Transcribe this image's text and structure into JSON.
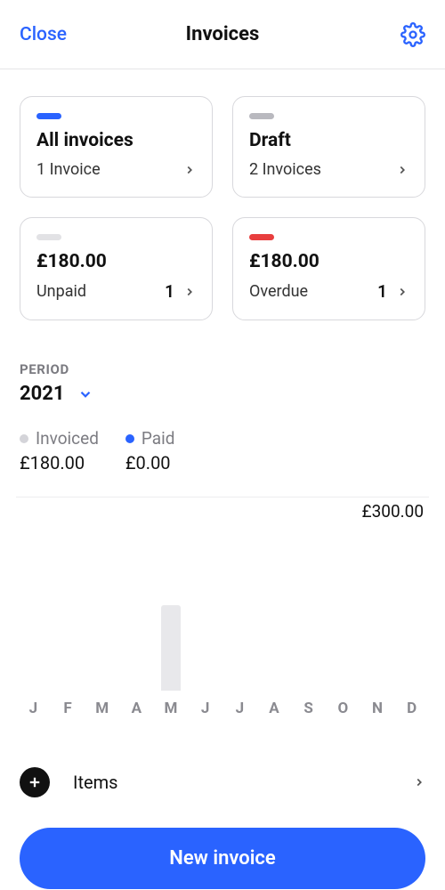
{
  "header": {
    "close": "Close",
    "title": "Invoices"
  },
  "cards": {
    "all": {
      "title": "All invoices",
      "sub": "1 Invoice"
    },
    "draft": {
      "title": "Draft",
      "sub": "2 Invoices"
    },
    "unpaid": {
      "amount": "£180.00",
      "label": "Unpaid",
      "count": "1"
    },
    "overdue": {
      "amount": "£180.00",
      "label": "Overdue",
      "count": "1"
    }
  },
  "period": {
    "label": "PERIOD",
    "year": "2021",
    "legend": {
      "invoiced": {
        "name": "Invoiced",
        "value": "£180.00"
      },
      "paid": {
        "name": "Paid",
        "value": "£0.00"
      }
    }
  },
  "chart_data": {
    "type": "bar",
    "categories": [
      "J",
      "F",
      "M",
      "A",
      "M",
      "J",
      "J",
      "A",
      "S",
      "O",
      "N",
      "D"
    ],
    "series": [
      {
        "name": "Invoiced",
        "values": [
          0,
          0,
          0,
          0,
          180,
          0,
          0,
          0,
          0,
          0,
          0,
          0
        ]
      },
      {
        "name": "Paid",
        "values": [
          0,
          0,
          0,
          0,
          0,
          0,
          0,
          0,
          0,
          0,
          0,
          0
        ]
      }
    ],
    "ylim": [
      0,
      300
    ],
    "y_tick_label": "£300.00",
    "xlabel": "",
    "ylabel": ""
  },
  "items": {
    "label": "Items"
  },
  "cta": {
    "new_invoice": "New invoice"
  }
}
